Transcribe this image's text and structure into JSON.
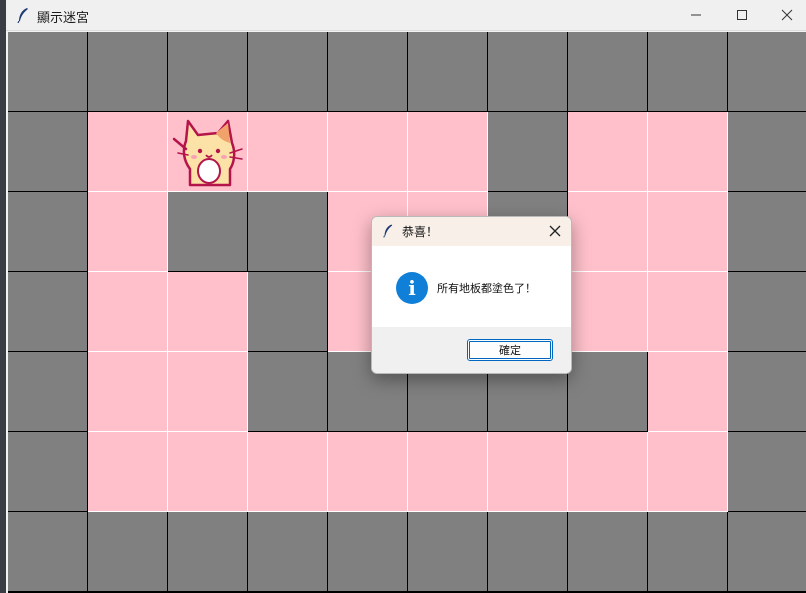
{
  "window": {
    "title": "顯示迷宮",
    "icon": "feather-icon",
    "controls": [
      "minimize-icon",
      "maximize-icon",
      "close-icon"
    ]
  },
  "maze": {
    "columns": 10,
    "rows": 7,
    "legend": {
      "W": "wall",
      "F": "floor"
    },
    "grid": [
      "WWWWWWWWWW",
      "WFFFFFWFFW",
      "WFWWFFWFFW",
      "WFFWFFFFFW",
      "WFFWWWWWFW",
      "WFFFFFFFFW",
      "WWWWWWWWWW"
    ],
    "colors": {
      "wall": "#808080",
      "floor": "#ffc0cb",
      "wall_line": "#000000",
      "floor_line": "#ffffff"
    },
    "player": {
      "row": 1,
      "col": 2,
      "icon": "cat-icon"
    }
  },
  "dialog": {
    "title": "恭喜！",
    "message": "所有地板都塗色了！",
    "ok_label": "確定",
    "icon": "info-icon",
    "icon_glyph": "i"
  }
}
